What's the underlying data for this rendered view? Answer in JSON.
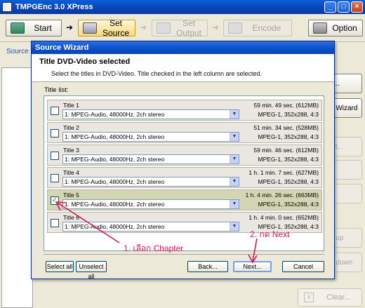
{
  "window": {
    "title": "TMPGEnc 3.0 XPress",
    "controls": [
      "_",
      "□",
      "×"
    ]
  },
  "toolbar": {
    "start": "Start",
    "set_source": "Set Source",
    "set_output": "Set Output",
    "encode": "Encode",
    "option": "Option",
    "arrow": "➜"
  },
  "background": {
    "source_info_tab": "Source info",
    "btn_browse": "e...",
    "btn_wizard": "e Wizard",
    "btn_edit": "dit...",
    "btn_up": "e up",
    "btn_down": "e down",
    "btn_clear": "Clear...",
    "btn_clear_x": "x"
  },
  "dialog": {
    "title": "Source Wizard",
    "heading": "Title DVD-Video selected",
    "description": "Select the titles in DVD-Video. Title checked in the left column are selected.",
    "list_label": "Title list:",
    "titles": [
      {
        "name": "Title 1",
        "audio": "1: MPEG-Audio, 48000Hz, 2ch stereo",
        "duration": "59 min. 49 sec. (612MB)",
        "format": "MPEG-1, 352x288, 4:3",
        "checked": false
      },
      {
        "name": "Title 2",
        "audio": "1: MPEG-Audio, 48000Hz, 2ch stereo",
        "duration": "51 min. 34 sec. (528MB)",
        "format": "MPEG-1, 352x288, 4:3",
        "checked": false
      },
      {
        "name": "Title 3",
        "audio": "1: MPEG-Audio, 48000Hz, 2ch stereo",
        "duration": "59 min. 46 sec. (612MB)",
        "format": "MPEG-1, 352x288, 4:3",
        "checked": false
      },
      {
        "name": "Title 4",
        "audio": "1: MPEG-Audio, 48000Hz, 2ch stereo",
        "duration": "1 h. 1 min. 7 sec. (627MB)",
        "format": "MPEG-1, 352x288, 4:3",
        "checked": false
      },
      {
        "name": "Title 5",
        "audio": "1: MPEG-Audio, 48000Hz, 2ch stereo",
        "duration": "1 h. 4 min. 26 sec. (663MB)",
        "format": "MPEG-1, 352x288, 4:3",
        "checked": true
      },
      {
        "name": "Title 6",
        "audio": "1: MPEG-Audio, 48000Hz, 2ch stereo",
        "duration": "1 h. 4 min. 0 sec. (652MB)",
        "format": "MPEG-1, 352x288, 4:3",
        "checked": false
      }
    ],
    "buttons": {
      "select_all": "Select all",
      "unselect_all": "Unselect all",
      "back": "Back...",
      "next": "Next...",
      "cancel": "Cancel"
    },
    "checkmark": "✓",
    "dropdown_arrow": "▼"
  },
  "annotations": {
    "step1": "1. เลือก Chapter",
    "step2": "2. กด Next",
    "color": "#e0125a"
  }
}
